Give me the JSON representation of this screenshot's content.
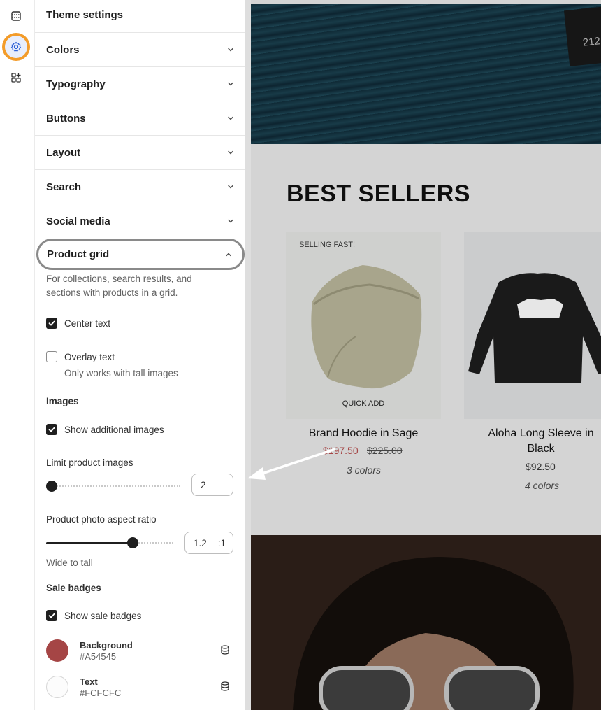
{
  "rail": {
    "items": [
      {
        "icon": "sections-icon"
      },
      {
        "icon": "gear-icon",
        "active": true
      },
      {
        "icon": "add-block-icon"
      }
    ]
  },
  "panel": {
    "title": "Theme settings",
    "sections": [
      "Colors",
      "Typography",
      "Buttons",
      "Layout",
      "Search",
      "Social media"
    ],
    "open_section": {
      "label": "Product grid",
      "description": "For collections, search results, and sections with products in a grid.",
      "center_text": {
        "label": "Center text",
        "checked": true
      },
      "overlay_text": {
        "label": "Overlay text",
        "checked": false,
        "helper": "Only works with tall images"
      },
      "images_heading": "Images",
      "show_additional": {
        "label": "Show additional images",
        "checked": true
      },
      "limit_images": {
        "label": "Limit product images",
        "value": "2"
      },
      "aspect_ratio": {
        "label": "Product photo aspect ratio",
        "value": "1.2",
        "suffix": ":1",
        "helper": "Wide to tall"
      },
      "sale_heading": "Sale badges",
      "show_sale": {
        "label": "Show sale badges",
        "checked": true
      },
      "background": {
        "label": "Background",
        "hex": "#A54545"
      },
      "text": {
        "label": "Text",
        "hex": "#FCFCFC"
      }
    }
  },
  "preview": {
    "hero_tag": "212",
    "section_title": "BEST SELLERS",
    "products": [
      {
        "badge": "SELLING FAST!",
        "quick_add": "QUICK ADD",
        "name": "Brand Hoodie in Sage",
        "sale_price": "$197.50",
        "compare_price": "$225.00",
        "colors": "3 colors"
      },
      {
        "name_line1": "Aloha Long Sleeve in",
        "name_line2": "Black",
        "price": "$92.50",
        "colors": "4 colors"
      }
    ]
  }
}
